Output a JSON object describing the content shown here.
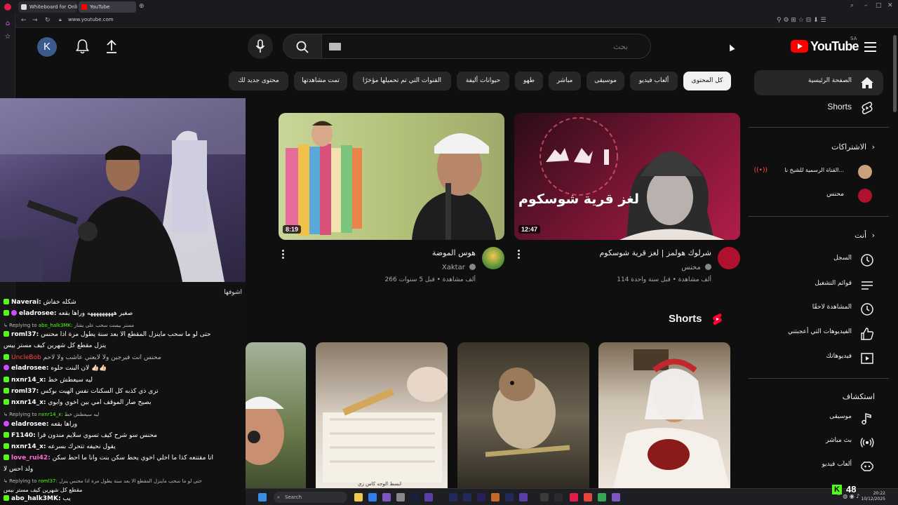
{
  "browser": {
    "tabs": [
      {
        "label": "Whiteboard for Online Co"
      },
      {
        "label": "YouTube"
      }
    ],
    "url": "www.youtube.com"
  },
  "header": {
    "avatar_letter": "K",
    "search_placeholder": "بحث",
    "logo_text": "YouTube",
    "country_code": "SA"
  },
  "chips": [
    "كل المحتوى",
    "ألعاب فيديو",
    "موسيقى",
    "مباشر",
    "طهو",
    "حيوانات أليفة",
    "القنوات التي تم تحميلها مؤخرًا",
    "تمت مشاهدتها",
    "محتوى جديد لك"
  ],
  "sidebar": {
    "home": "الصفحة الرئيسية",
    "shorts": "Shorts",
    "subscriptions_heading": "الاشتراكات",
    "subscriptions": [
      {
        "name": "القناة الرسمية للشيخ نا..."
      },
      {
        "name": "محنس"
      }
    ],
    "you_heading": "أنت",
    "you_items": [
      {
        "label": "السجل"
      },
      {
        "label": "قوائم التشغيل"
      },
      {
        "label": "المشاهدة لاحقًا"
      },
      {
        "label": "الفيديوهات التي أعجبتني"
      },
      {
        "label": "فيديوهاتك"
      }
    ],
    "explore_heading": "استكشاف",
    "explore_items": [
      {
        "label": "موسيقى"
      },
      {
        "label": "بث مباشر"
      },
      {
        "label": "ألعاب فيديو"
      }
    ]
  },
  "videos": [
    {
      "title": "شرلوك هولمز | لغز قرية شوسكوم",
      "channel": "محنس",
      "meta": "114 ألف مشاهدة • قبل سنة واحدة",
      "duration": "12:47",
      "overlay_text": "لغز قرية شوسكوم"
    },
    {
      "title": "هوس الموضة",
      "channel": "Xaktar",
      "meta": "266 ألف مشاهدة • قبل 5 سنوات",
      "duration": "8:19"
    }
  ],
  "shorts": {
    "title": "Shorts",
    "items": [
      {
        "caption": ""
      },
      {
        "caption": ""
      },
      {
        "caption": "ابسط الوجه كاس زي"
      },
      {
        "caption": ""
      }
    ]
  },
  "chat": {
    "lines": [
      {
        "user": "",
        "text": "أشوفها",
        "color": "#ffffff"
      },
      {
        "user": "Naverai:",
        "text": "شكله خفاش",
        "color": "#53fc18"
      },
      {
        "user": "eladrosee:",
        "text": "صغير هههههههههه وراها بقعه",
        "color": "#ffffff"
      },
      {
        "reply": "Replying to",
        "reply_user": "abo_halk3MK:",
        "reply_text": "مستر بيست سحب على بشار"
      },
      {
        "user": "roml37:",
        "text": "حتى لو ما سحب ماينزل المقطع الا بعد سنة يطول مرة اذا محنس",
        "color": "#ffffff"
      },
      {
        "user": "",
        "text": "ينزل مقطع كل شهرين كيف مستر بيس",
        "color": "#ffffff"
      },
      {
        "user": "",
        "text": "محنس انت فيرجين ولا لايعتي عاشب ولا لاحم",
        "color": "#dddddd"
      },
      {
        "user": "eladrosee:",
        "text": "لان البنت حلوه 👍🏻👍🏻",
        "color": "#ffffff"
      },
      {
        "user": "nxnr14_x:",
        "text": "ليه سيعطش خط",
        "color": "#ffffff"
      },
      {
        "user": "roml37:",
        "text": "ترى ذي كذبه كل السكنات نفس الهيت بوكس",
        "color": "#ffffff"
      },
      {
        "user": "nxnr14_x:",
        "text": "بصيح صار الموقف امي بين اخوي وابوي",
        "color": "#ffffff"
      },
      {
        "reply": "Replying to",
        "reply_user": "nxnr14_x:",
        "reply_text": "ليه سيعطش خط"
      },
      {
        "user": "eladrosee:",
        "text": "وراها بقعه",
        "color": "#ffffff"
      },
      {
        "user": "F1140:",
        "text": "محنس سو شرح كيف تسوي سلايم مندون قرا",
        "color": "#ffffff"
      },
      {
        "user": "nxnr14_x:",
        "text": "يقول نحيفه تتحرك بسرعه",
        "color": "#ffffff"
      },
      {
        "user": "love_rui42:",
        "text": "أنا مقتنعه كذا ما اخلي اخوي يحط سكن بنت وانا ما أحط سكن",
        "color": "#ffffff"
      },
      {
        "user": "",
        "text": "ولد احس لا",
        "color": "#ffffff"
      },
      {
        "reply": "Replying to",
        "reply_user": "roml37:",
        "reply_text": "حتى لو ما سحب ماينزل المقطع الا بعد سنة يطول مرة اذا محنس ينزل"
      },
      {
        "user": "",
        "text": "مقطع كل شهرين كيف مستر بيس",
        "color": "#dddddd"
      },
      {
        "user": "abo_halk3MK:",
        "text": "يب",
        "color": "#ffffff"
      }
    ]
  },
  "taskbar": {
    "search_label": "Search",
    "time": "20:22",
    "date": "10/12/2025"
  },
  "kick": {
    "viewer_count": "48",
    "logo_letter": "K"
  },
  "colors": {
    "accent_red": "#ff0000",
    "kick_green": "#53fc18",
    "background": "#0f0f0f"
  }
}
